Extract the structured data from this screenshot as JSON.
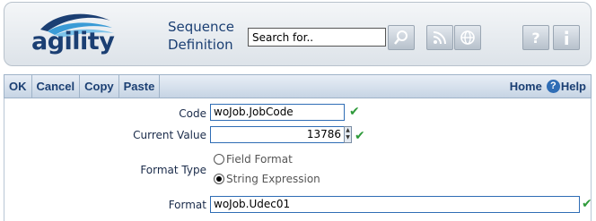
{
  "header": {
    "logo_text": "agility",
    "title": "Sequence Definition",
    "search": {
      "placeholder": "Search for..",
      "value": ""
    },
    "buttons": [
      {
        "name": "search-button",
        "icon": "magnifier-icon"
      },
      {
        "name": "rss-button",
        "icon": "rss-icon"
      },
      {
        "name": "web-button",
        "icon": "globe-icon"
      },
      {
        "name": "help-button",
        "icon": "question-icon"
      },
      {
        "name": "info-button",
        "icon": "info-icon"
      }
    ]
  },
  "toolbar": {
    "ok": "OK",
    "cancel": "Cancel",
    "copy": "Copy",
    "paste": "Paste",
    "home": "Home",
    "help": "Help"
  },
  "form": {
    "code": {
      "label": "Code",
      "value": "woJob.JobCode"
    },
    "current_value": {
      "label": "Current Value",
      "value": "13786"
    },
    "format_type": {
      "label": "Format Type",
      "options": [
        "Field Format",
        "String Expression"
      ],
      "selected": "String Expression"
    },
    "format": {
      "label": "Format",
      "value": "woJob.Udec01"
    }
  },
  "colors": {
    "brand": "#1b3f73",
    "field_border": "#2f6db5",
    "check": "#2e9a3a"
  }
}
